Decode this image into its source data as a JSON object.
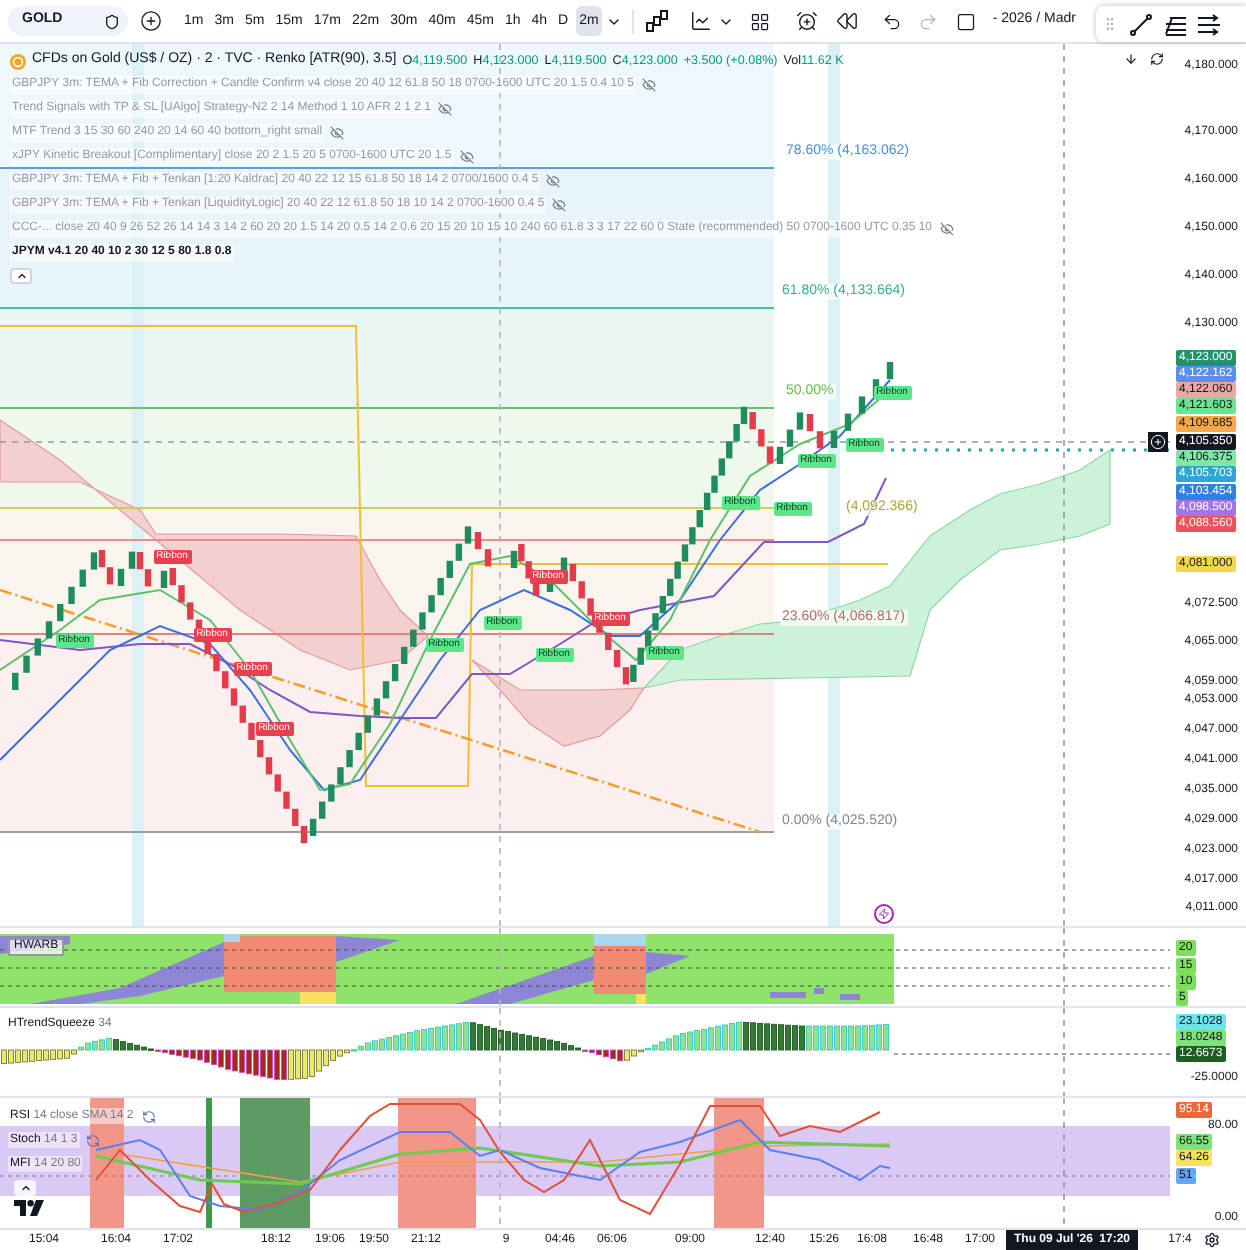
{
  "toolbar": {
    "symbol": "GOLD",
    "intervals": [
      {
        "label": "1m",
        "selected": false
      },
      {
        "label": "3m",
        "selected": false
      },
      {
        "label": "5m",
        "selected": false
      },
      {
        "label": "15m",
        "selected": false
      },
      {
        "label": "17m",
        "selected": false
      },
      {
        "label": "22m",
        "selected": false
      },
      {
        "label": "30m",
        "selected": false
      },
      {
        "label": "40m",
        "selected": false
      },
      {
        "label": "45m",
        "selected": false
      },
      {
        "label": "1h",
        "selected": false
      },
      {
        "label": "4h",
        "selected": false
      },
      {
        "label": "D",
        "selected": false
      },
      {
        "label": "2m",
        "selected": true
      }
    ],
    "layout_title": "- 2026 / Madr"
  },
  "legend": {
    "title": "CFDs on Gold (US$ / OZ) · 2 · TVC · Renko [ATR(90), 3.5]",
    "ohlc": [
      {
        "label": "O",
        "value": "4,119.500"
      },
      {
        "label": "H",
        "value": "4,123.000"
      },
      {
        "label": "L",
        "value": "4,119.500"
      },
      {
        "label": "C",
        "value": "4,123.000"
      }
    ],
    "change": "+3.500 (+0.08%)",
    "volume": {
      "label": "Vol",
      "value": "11.62 K"
    }
  },
  "indicators": [
    {
      "text": "GBPJPY 3m: TEMA + Fib Correction + Candle Confirm v4 close 20 40 12 61.8 50 18 0700-1600 UTC 20 1.5 0.4 10 5",
      "hidden": true
    },
    {
      "text": "Trend Signals with TP & SL [UAlgo] Strategy-N2 2 14 Method 1 10 AFR 2 1 2 1",
      "hidden": true
    },
    {
      "text": "MTF Trend 3 15 30 60 240 20 14 60 40 bottom_right small",
      "hidden": true
    },
    {
      "text": "xJPY Kinetic Breakout [Complimentary] close 20 2 1.5 20 5 0700-1600 UTC 20 1.5",
      "hidden": true
    },
    {
      "text": "GBPJPY 3m: TEMA + Fib + Tenkan [1:20 Kaldrac] 20 40 22 12 15 61.8 50 18 14 2 0700/1600 0.4 5",
      "hidden": true
    },
    {
      "text": "GBPJPY 3m: TEMA + Fib + Tenkan [LiquidityLogic] 20 40 22 12 61.8 50 18 10 14 2 0700-1600 0.4 5",
      "hidden": true
    },
    {
      "text": "CCC-... close 20 40 9 26 52 26 14 14 3 14 2 60 20 20 1.5 14 20 0.5 14 2 0.6 20 15 20 10 15 10 240 60 61.8 3 3 17 22 60 0 State (recommended) 50 0700-1600 UTC 0.35 10",
      "hidden": true
    },
    {
      "text": "JPYM v4.1 20 40 10 2 30 12 5 80 1.8 0.8",
      "hidden": false
    }
  ],
  "fib_levels": [
    {
      "text": "78.60% (4,163.062)",
      "color": "#4a90d9"
    },
    {
      "text": "61.80% (4,133.664)",
      "color": "#36b08e"
    },
    {
      "text": "50.00%",
      "color": "#67b84a"
    },
    {
      "text": "(4,092.366)",
      "color": "#aaa832"
    },
    {
      "text": "23.60% (4,066.817)",
      "color": "#b86a6a"
    },
    {
      "text": "0.00% (4,025.520)",
      "color": "#80868b"
    }
  ],
  "signals": [
    {
      "text": "Ribbon",
      "kind": "bull"
    },
    {
      "text": "Ribbon",
      "kind": "bear"
    },
    {
      "text": "Ribbon",
      "kind": "bear"
    },
    {
      "text": "Ribbon",
      "kind": "bear"
    },
    {
      "text": "Ribbon",
      "kind": "bear"
    },
    {
      "text": "Ribbon",
      "kind": "bull"
    },
    {
      "text": "Ribbon",
      "kind": "bull"
    },
    {
      "text": "Ribbon",
      "kind": "bear"
    },
    {
      "text": "Ribbon",
      "kind": "bull"
    },
    {
      "text": "Ribbon",
      "kind": "bear"
    },
    {
      "text": "Ribbon",
      "kind": "bull"
    },
    {
      "text": "Ribbon",
      "kind": "bull"
    },
    {
      "text": "Ribbon",
      "kind": "bull"
    },
    {
      "text": "Ribbon",
      "kind": "bull"
    },
    {
      "text": "Ribbon",
      "kind": "bull"
    },
    {
      "text": "Ribbon",
      "kind": "bull"
    }
  ],
  "price_axis": [
    {
      "text": "4,180.000",
      "kind": "tick"
    },
    {
      "text": "4,170.000",
      "kind": "tick"
    },
    {
      "text": "4,160.000",
      "kind": "tick"
    },
    {
      "text": "4,150.000",
      "kind": "tick"
    },
    {
      "text": "4,140.000",
      "kind": "tick"
    },
    {
      "text": "4,130.000",
      "kind": "tick"
    },
    {
      "text": "4,123.000",
      "kind": "tag",
      "color": "#22926b"
    },
    {
      "text": "4,122.162",
      "kind": "tag",
      "color": "#5b8def"
    },
    {
      "text": "4,122.060",
      "kind": "tag",
      "color": "#eaa8a4"
    },
    {
      "text": "4,121.603",
      "kind": "tag",
      "color": "#6fe28f"
    },
    {
      "text": "4,109.685",
      "kind": "tag",
      "color": "#f3a948"
    },
    {
      "text": "4,105.350",
      "kind": "tag",
      "color": "#131722"
    },
    {
      "text": "4,106.375",
      "kind": "tag",
      "color": "#7fe9a3"
    },
    {
      "text": "4,105.703",
      "kind": "tag",
      "color": "#2da6d6"
    },
    {
      "text": "4,103.454",
      "kind": "tag",
      "color": "#2f80e3"
    },
    {
      "text": "4,098.500",
      "kind": "tag",
      "color": "#a374e3"
    },
    {
      "text": "4,088.560",
      "kind": "tag",
      "color": "#f0525c"
    },
    {
      "text": "4,081.000",
      "kind": "tag",
      "color": "#f2d64c"
    },
    {
      "text": "4,072.500",
      "kind": "tick"
    },
    {
      "text": "4,065.000",
      "kind": "tick"
    },
    {
      "text": "4,059.000",
      "kind": "tick"
    },
    {
      "text": "4,053.000",
      "kind": "tick"
    },
    {
      "text": "4,047.000",
      "kind": "tick"
    },
    {
      "text": "4,041.000",
      "kind": "tick"
    },
    {
      "text": "4,035.000",
      "kind": "tick"
    },
    {
      "text": "4,029.000",
      "kind": "tick"
    },
    {
      "text": "4,023.000",
      "kind": "tick"
    },
    {
      "text": "4,017.000",
      "kind": "tick"
    },
    {
      "text": "4,011.000",
      "kind": "tick"
    }
  ],
  "panes": [
    {
      "name": "HWARB",
      "axis": [
        {
          "text": "20",
          "kind": "tag"
        },
        {
          "text": "15",
          "kind": "tag"
        },
        {
          "text": "10",
          "kind": "tag"
        },
        {
          "text": "5",
          "kind": "tag"
        }
      ]
    },
    {
      "name": "HTrendSqueeze",
      "params": "34",
      "axis": [
        {
          "text": "23.1028",
          "kind": "tag",
          "color": "#6ee3f2"
        },
        {
          "text": "18.0248",
          "kind": "tag",
          "color": "#7fe27a"
        },
        {
          "text": "12.6673",
          "kind": "tag",
          "color": "#1e5e24"
        },
        {
          "text": "-25.0000",
          "kind": "tick"
        }
      ]
    },
    {
      "legend": [
        {
          "name": "RSI",
          "params": "14 close SMA 14 2",
          "synced": true
        },
        {
          "name": "Stoch",
          "params": "14 1 3",
          "synced": true
        },
        {
          "name": "MFI",
          "params": "14 20 80",
          "synced": false
        }
      ],
      "axis": [
        {
          "text": "95.14",
          "kind": "tag",
          "color": "#f0643c"
        },
        {
          "text": "80.00",
          "kind": "tick"
        },
        {
          "text": "66.55",
          "kind": "tag",
          "color": "#7fe27a"
        },
        {
          "text": "64.26",
          "kind": "tag",
          "color": "#f5e35a"
        },
        {
          "text": "51",
          "kind": "tag",
          "color": "#63a8f2"
        },
        {
          "text": "0.00",
          "kind": "tick"
        }
      ]
    }
  ],
  "time_axis": {
    "labels": [
      "15:04",
      "16:04",
      "17:02",
      "18:12",
      "19:06",
      "19:50",
      "21:12",
      "9",
      "04:46",
      "06:06",
      "09:00",
      "12:40",
      "15:26",
      "16:08",
      "16:48",
      "17:00",
      "17:4"
    ],
    "crosshair": {
      "date": "Thu 09 Jul '26",
      "time": "17:20"
    }
  }
}
